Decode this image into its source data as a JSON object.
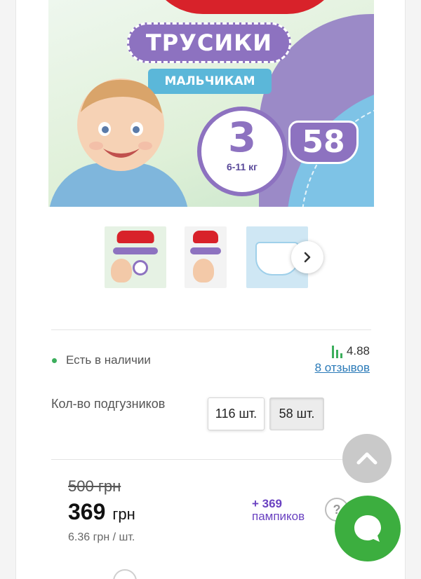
{
  "product_image": {
    "title": "ТРУСИКИ",
    "subtitle": "МАЛЬЧИКАМ",
    "size": "3",
    "weight": "6-11 кг",
    "count": "58"
  },
  "thumbnails": [
    {
      "name": "pack-front"
    },
    {
      "name": "pack-side"
    },
    {
      "name": "diaper-closeup"
    }
  ],
  "availability": {
    "status": "Есть в наличии",
    "status_color": "#3cae5c"
  },
  "rating": {
    "value": "4.88",
    "reviews": "8 отзывов"
  },
  "quantity": {
    "label": "Кол-во подгузников",
    "options": [
      "116 шт.",
      "58 шт."
    ],
    "selected": "58 шт."
  },
  "price": {
    "old": "500 грн",
    "current": "369",
    "currency": "грн",
    "per_unit": "6.36 грн / шт."
  },
  "bonus": {
    "amount": "+ 369",
    "label": "пампиков",
    "color": "#6a42c1"
  },
  "help": {
    "icon": "?"
  },
  "colors": {
    "accent_green": "#3cae3f",
    "link_blue": "#2a7ab8"
  }
}
